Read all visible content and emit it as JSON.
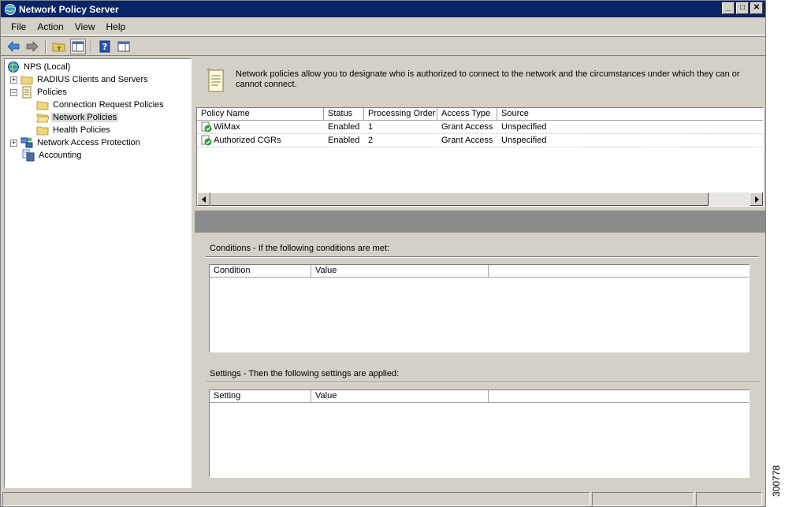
{
  "window": {
    "title": "Network Policy Server"
  },
  "menu": [
    "File",
    "Action",
    "View",
    "Help"
  ],
  "toolbar": {
    "icons": [
      "back-arrow-icon",
      "forward-arrow-icon",
      "up-folder-icon",
      "show-hide-tree-icon",
      "help-icon",
      "console-pane-icon"
    ]
  },
  "tree": {
    "root": "NPS (Local)",
    "radius": "RADIUS Clients and Servers",
    "policies": "Policies",
    "connection_request": "Connection Request Policies",
    "network_policies": "Network Policies",
    "health_policies": "Health Policies",
    "nap": "Network Access Protection",
    "accounting": "Accounting"
  },
  "info": {
    "text": "Network policies allow you to designate who is authorized to connect to the network and the circumstances under which they can or cannot connect."
  },
  "policies": {
    "columns": [
      "Policy Name",
      "Status",
      "Processing Order",
      "Access Type",
      "Source"
    ],
    "rows": [
      {
        "name": "WiMax",
        "status": "Enabled",
        "order": "1",
        "access": "Grant Access",
        "source": "Unspecified"
      },
      {
        "name": "Authorized CGRs",
        "status": "Enabled",
        "order": "2",
        "access": "Grant Access",
        "source": "Unspecified"
      }
    ]
  },
  "conditions": {
    "label": "Conditions - If the following conditions are met:",
    "col1": "Condition",
    "col2": "Value"
  },
  "settings": {
    "label": "Settings - Then the following settings are applied:",
    "col1": "Setting",
    "col2": "Value"
  },
  "image_id": "300778",
  "colors": {
    "titlebar": "#0a246a",
    "chrome": "#d4d0c8",
    "divider": "#8c8c8c"
  }
}
